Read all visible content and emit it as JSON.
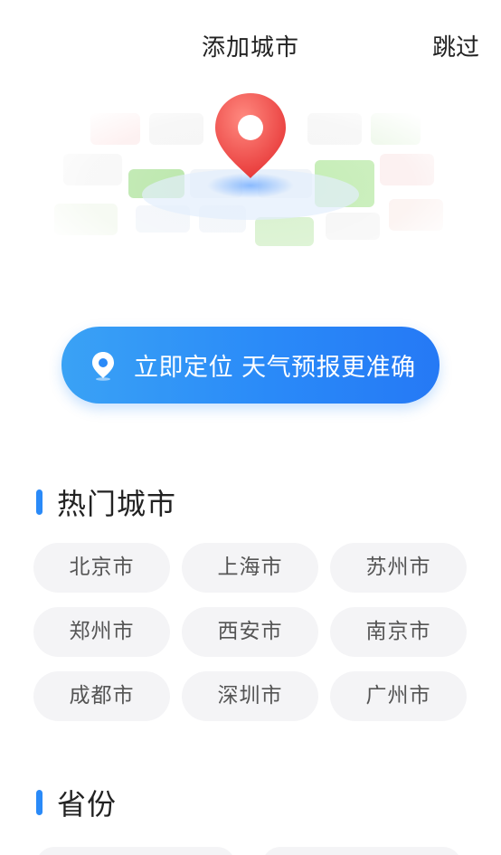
{
  "header": {
    "title": "添加城市",
    "skip_label": "跳过"
  },
  "locate": {
    "label": "立即定位 天气预报更准确",
    "icon": "location-pin-icon"
  },
  "hot_cities": {
    "title": "热门城市",
    "items": [
      "北京市",
      "上海市",
      "苏州市",
      "郑州市",
      "西安市",
      "南京市",
      "成都市",
      "深圳市",
      "广州市"
    ]
  },
  "provinces": {
    "title": "省份"
  },
  "colors": {
    "accent": "#2a8af8",
    "chip_bg": "#f4f4f6",
    "pin_red": "#ef4747"
  }
}
